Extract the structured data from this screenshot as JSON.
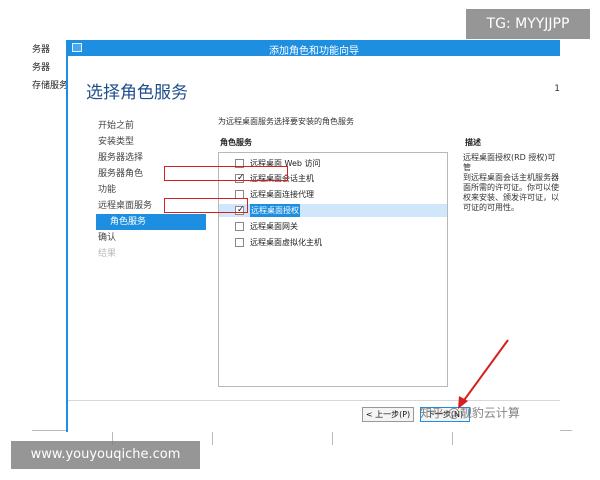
{
  "background": {
    "sidebar_items": [
      "务器",
      "务器",
      "存储服务"
    ]
  },
  "wizard": {
    "title": "添加角色和功能向导",
    "header_title": "选择角色服务",
    "header_right": "1",
    "steps": [
      {
        "label": "开始之前",
        "state": "normal"
      },
      {
        "label": "安装类型",
        "state": "normal"
      },
      {
        "label": "服务器选择",
        "state": "normal"
      },
      {
        "label": "服务器角色",
        "state": "normal"
      },
      {
        "label": "功能",
        "state": "normal"
      },
      {
        "label": "远程桌面服务",
        "state": "normal"
      },
      {
        "label": "角色服务",
        "state": "active"
      },
      {
        "label": "确认",
        "state": "normal"
      },
      {
        "label": "结果",
        "state": "disabled"
      }
    ],
    "instruction": "为远程桌面服务选择要安装的角色服务",
    "roles_header": "角色服务",
    "description_header": "描述",
    "roles": [
      {
        "label": "远程桌面 Web 访问",
        "checked": false,
        "selected": false
      },
      {
        "label": "远程桌面会话主机",
        "checked": true,
        "selected": false
      },
      {
        "label": "远程桌面连接代理",
        "checked": false,
        "selected": false
      },
      {
        "label": "远程桌面授权",
        "checked": true,
        "selected": true
      },
      {
        "label": "远程桌面网关",
        "checked": false,
        "selected": false
      },
      {
        "label": "远程桌面虚拟化主机",
        "checked": false,
        "selected": false
      }
    ],
    "description_text": "远程桌面授权(RD 授权)可管\n到远程桌面会话主机服务器\n面所需的许可证。你可以使\n权来安装、颁发许可证，以\n可证的可用性。",
    "buttons": {
      "previous": "< 上一步(P)",
      "next": "下一步(N)"
    }
  },
  "watermarks": {
    "tg": "TG: MYYJJPP",
    "site": "www.youyouqiche.com",
    "zhihu": "知乎 @靓豹云计算"
  },
  "colors": {
    "accent": "#1e8fe0",
    "header_text": "#1f4e8c",
    "highlight_red": "#d42020"
  }
}
